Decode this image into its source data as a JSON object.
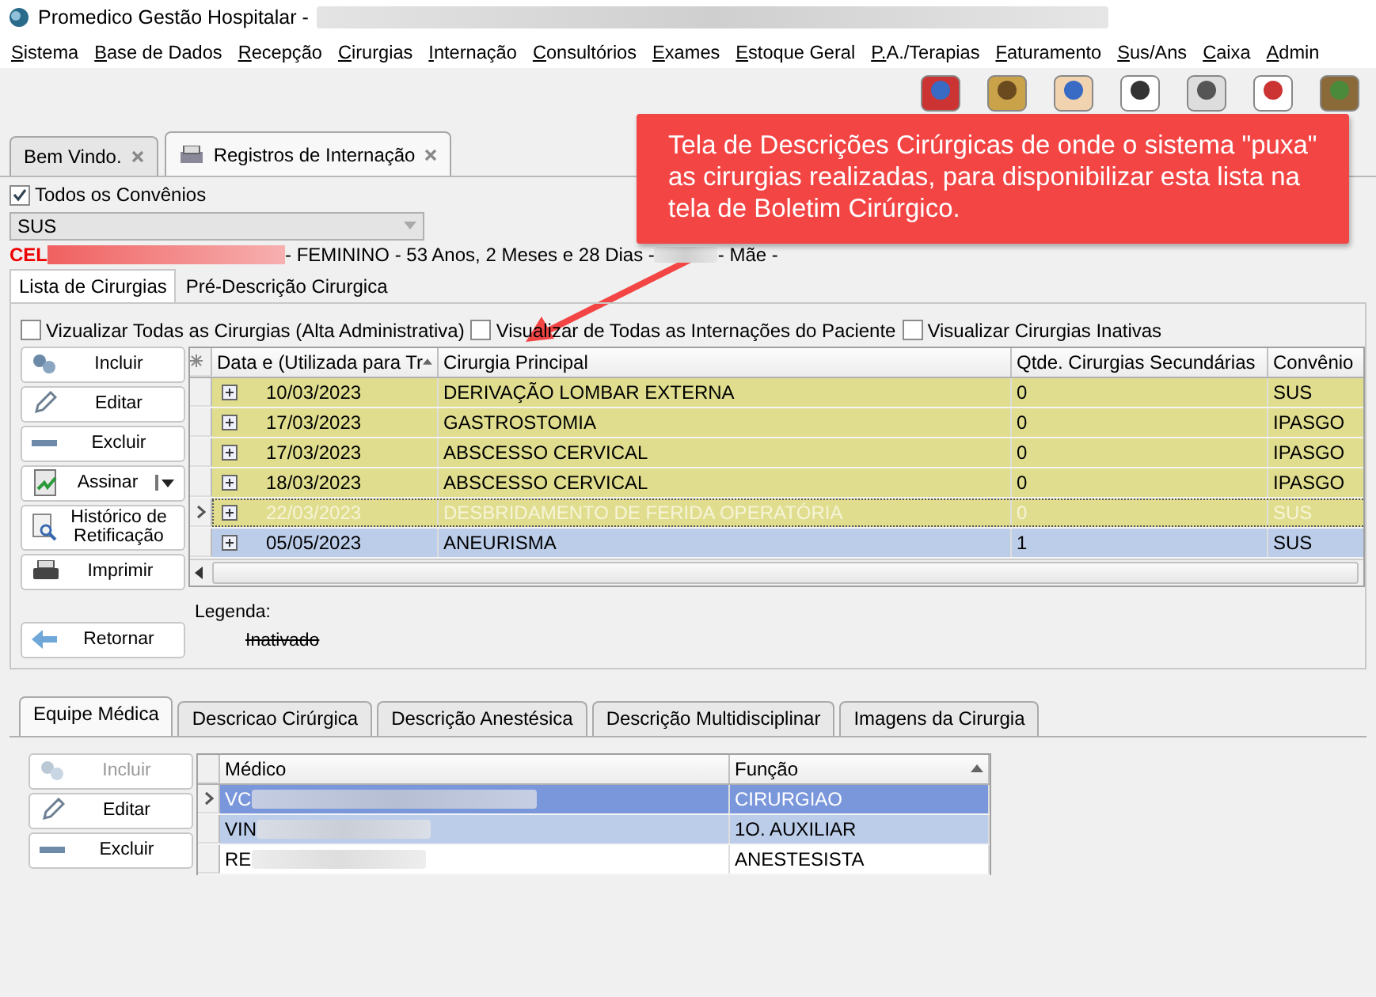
{
  "window": {
    "title": "Promedico Gestão Hospitalar -"
  },
  "menu": [
    "Sistema",
    "Base de Dados",
    "Recepção",
    "Cirurgias",
    "Internação",
    "Consultórios",
    "Exames",
    "Estoque Geral",
    "P.A./Terapias",
    "Faturamento",
    "Sus/Ans",
    "Caixa",
    "Admin"
  ],
  "doc_tabs": [
    {
      "label": "Bem Vindo.",
      "selected": false,
      "icon": false
    },
    {
      "label": "Registros de Internação",
      "selected": true,
      "icon": true
    }
  ],
  "callout": "Tela de Descrições Cirúrgicas de onde o sistema \"puxa\" as cirurgias realizadas, para disponibilizar esta lista na tela de Boletim Cirúrgico.",
  "all_insurers": {
    "label": "Todos os Convênios",
    "checked": true
  },
  "insurer_select": {
    "value": "SUS"
  },
  "patient": {
    "prefix": "CEL",
    "info": "- FEMININO - 53 Anos, 2 Meses e 28 Dias -",
    "mother": "- Mãe -"
  },
  "sub_tabs": [
    {
      "label": "Lista de Cirurgias",
      "selected": true
    },
    {
      "label": "Pré-Descrição Cirurgica",
      "selected": false
    }
  ],
  "filters": [
    {
      "label": "Vizualizar Todas as Cirurgias (Alta Administrativa)",
      "checked": false
    },
    {
      "label": "Visualizar de Todas as Internações do Paciente",
      "checked": false
    },
    {
      "label": "Visualizar Cirurgias Inativas",
      "checked": false
    }
  ],
  "actions": [
    {
      "label": "Incluir",
      "kind": "add",
      "disabled": false
    },
    {
      "label": "Editar",
      "kind": "edit",
      "disabled": false
    },
    {
      "label": "Excluir",
      "kind": "delete",
      "disabled": false
    },
    {
      "label": "Assinar",
      "kind": "sign",
      "disabled": false
    },
    {
      "label": "Histórico de Retificação",
      "kind": "history",
      "disabled": false
    },
    {
      "label": "Imprimir",
      "kind": "print",
      "disabled": false
    }
  ],
  "back_button": "Retornar",
  "surgeries": {
    "columns": [
      "Data e (Utilizada para Tr",
      "Cirurgia Principal",
      "Qtde. Cirurgias Secundárias",
      "Convênio"
    ],
    "rows": [
      {
        "date": "10/03/2023",
        "surgery": "DERIVAÇÃO LOMBAR EXTERNA",
        "secondary": "0",
        "insurer": "SUS",
        "color": "#e0de8e",
        "current": false,
        "faded": false
      },
      {
        "date": "17/03/2023",
        "surgery": "GASTROSTOMIA",
        "secondary": "0",
        "insurer": "IPASGO",
        "color": "#e0de8e",
        "current": false,
        "faded": false
      },
      {
        "date": "17/03/2023",
        "surgery": "ABSCESSO CERVICAL",
        "secondary": "0",
        "insurer": "IPASGO",
        "color": "#e0de8e",
        "current": false,
        "faded": false
      },
      {
        "date": "18/03/2023",
        "surgery": "ABSCESSO CERVICAL",
        "secondary": "0",
        "insurer": "IPASGO",
        "color": "#e0de8e",
        "current": false,
        "faded": false
      },
      {
        "date": "22/03/2023",
        "surgery": "DESBRIDAMENTO DE FERIDA OPERATÓRIA",
        "secondary": "0",
        "insurer": "SUS",
        "color": "#e0de8e",
        "current": true,
        "faded": true
      },
      {
        "date": "05/05/2023",
        "surgery": "ANEURISMA",
        "secondary": "1",
        "insurer": "SUS",
        "color": "#bccdea",
        "current": false,
        "faded": false
      }
    ]
  },
  "legend": {
    "title": "Legenda:",
    "items": [
      "Inativado"
    ]
  },
  "detail_tabs": [
    {
      "label": "Equipe Médica",
      "selected": true
    },
    {
      "label": "Descricao Cirúrgica",
      "selected": false
    },
    {
      "label": "Descrição Anestésica",
      "selected": false
    },
    {
      "label": "Descrição Multidisciplinar",
      "selected": false
    },
    {
      "label": "Imagens da Cirurgia",
      "selected": false
    }
  ],
  "team_actions": [
    {
      "label": "Incluir",
      "kind": "add",
      "disabled": true
    },
    {
      "label": "Editar",
      "kind": "edit",
      "disabled": false
    },
    {
      "label": "Excluir",
      "kind": "delete",
      "disabled": false
    }
  ],
  "team": {
    "columns": [
      "Médico",
      "Função"
    ],
    "rows": [
      {
        "doctor": "VC",
        "role": "CIRURGIAO",
        "color": "#7b97dc",
        "current": true
      },
      {
        "doctor": "VIN",
        "role": "1O. AUXILIAR",
        "color": "#bccdea",
        "current": false
      },
      {
        "doctor": "RE",
        "role": "ANESTESISTA",
        "color": "#ffffff",
        "current": false
      }
    ]
  }
}
